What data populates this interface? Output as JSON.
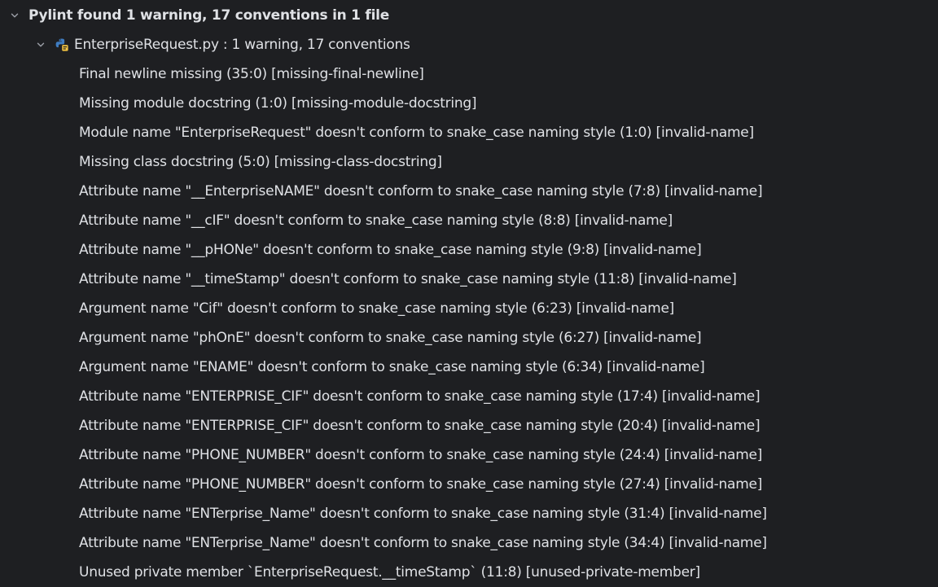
{
  "summary": {
    "label": "Pylint found 1 warning, 17 conventions  in 1 file"
  },
  "file": {
    "label": "EnterpriseRequest.py : 1 warning, 17 conventions"
  },
  "issues": [
    "Final newline missing (35:0) [missing-final-newline]",
    "Missing module docstring (1:0) [missing-module-docstring]",
    "Module name \"EnterpriseRequest\" doesn't conform to snake_case naming style (1:0) [invalid-name]",
    "Missing class docstring (5:0) [missing-class-docstring]",
    "Attribute name \"__EnterpriseNAME\" doesn't conform to snake_case naming style (7:8) [invalid-name]",
    "Attribute name \"__cIF\" doesn't conform to snake_case naming style (8:8) [invalid-name]",
    "Attribute name \"__pHONe\" doesn't conform to snake_case naming style (9:8) [invalid-name]",
    "Attribute name \"__timeStamp\" doesn't conform to snake_case naming style (11:8) [invalid-name]",
    "Argument name \"Cif\" doesn't conform to snake_case naming style (6:23) [invalid-name]",
    "Argument name \"phOnE\" doesn't conform to snake_case naming style (6:27) [invalid-name]",
    "Argument name \"ENAME\" doesn't conform to snake_case naming style (6:34) [invalid-name]",
    "Attribute name \"ENTERPRISE_CIF\" doesn't conform to snake_case naming style (17:4) [invalid-name]",
    "Attribute name \"ENTERPRISE_CIF\" doesn't conform to snake_case naming style (20:4) [invalid-name]",
    "Attribute name \"PHONE_NUMBER\" doesn't conform to snake_case naming style (24:4) [invalid-name]",
    "Attribute name \"PHONE_NUMBER\" doesn't conform to snake_case naming style (27:4) [invalid-name]",
    "Attribute name \"ENTerprise_Name\" doesn't conform to snake_case naming style (31:4) [invalid-name]",
    "Attribute name \"ENTerprise_Name\" doesn't conform to snake_case naming style (34:4) [invalid-name]",
    "Unused private member `EnterpriseRequest.__timeStamp` (11:8) [unused-private-member]"
  ],
  "icons": {
    "expand": "chevron-down-icon",
    "file": "python-file-icon"
  },
  "colors": {
    "background": "#1e1f22",
    "text": "#dfe1e5",
    "chevron": "#9da0a8",
    "python_blue": "#3f7cc0",
    "python_yellow": "#f4c542"
  }
}
